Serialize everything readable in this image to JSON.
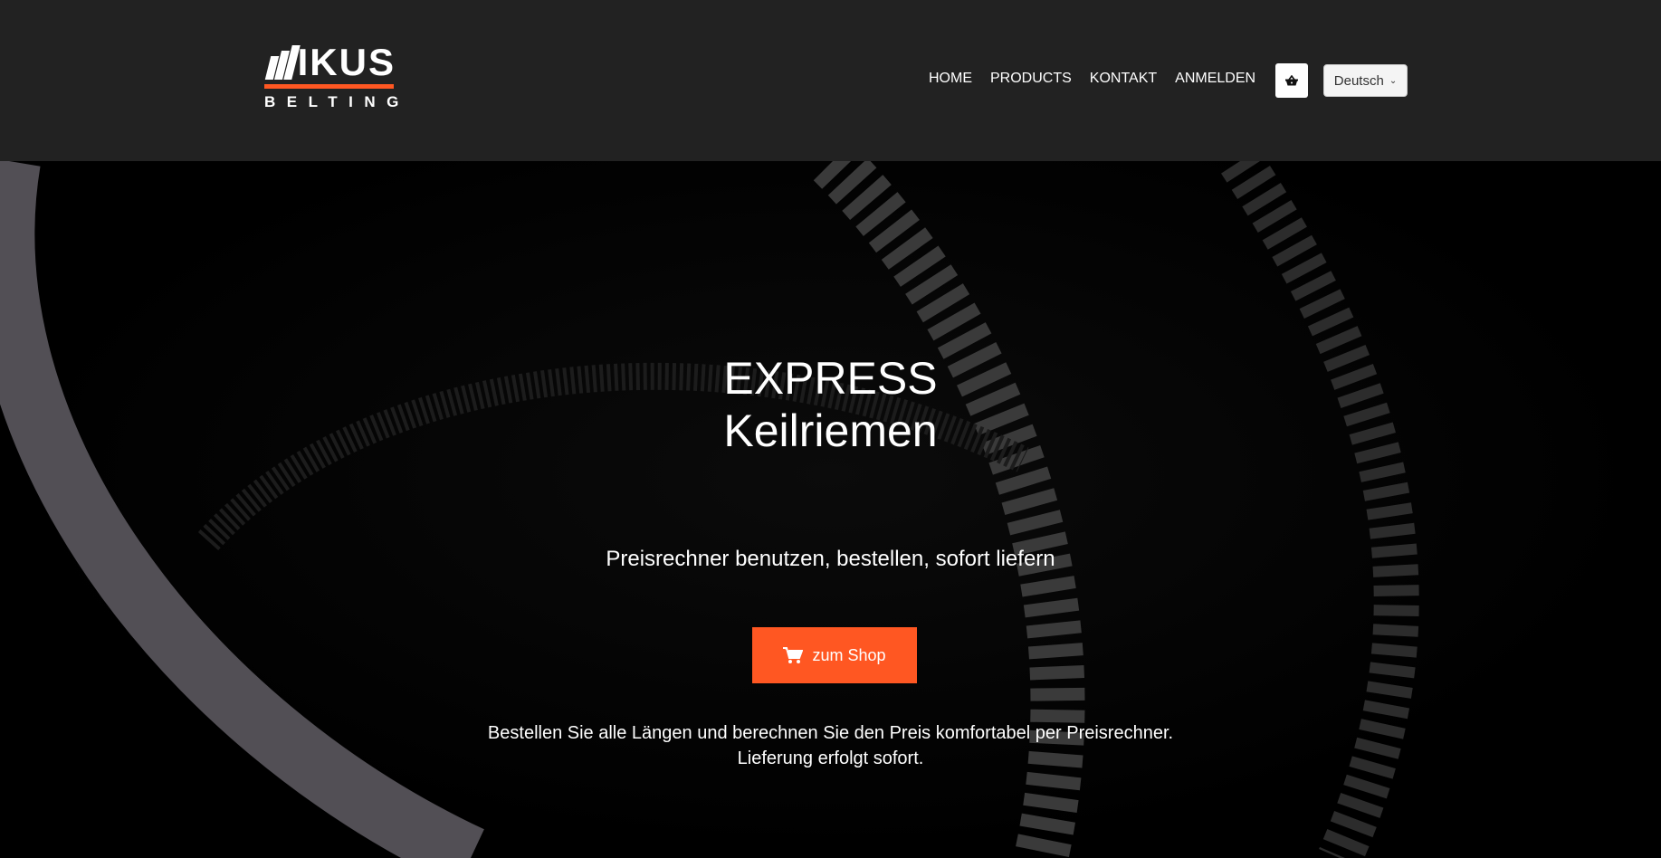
{
  "brand": {
    "logo_text": "MIKUS",
    "logo_subtext": "BELTING",
    "accent": "#ff5722"
  },
  "nav": {
    "items": [
      {
        "label": "HOME"
      },
      {
        "label": "PRODUCTS"
      },
      {
        "label": "KONTAKT"
      },
      {
        "label": "ANMELDEN"
      }
    ],
    "cart_icon": "basket-icon",
    "language": "Deutsch"
  },
  "hero": {
    "title_line1": "EXPRESS",
    "title_line2": "Keilriemen",
    "tagline": "Preisrechner benutzen, bestellen, sofort liefern",
    "button_label": "zum Shop",
    "button_icon": "cart-icon",
    "description_line1": "Bestellen Sie alle Längen und berechnen Sie den Preis komfortabel per Preisrechner.",
    "description_line2": "Lieferung erfolgt sofort."
  }
}
